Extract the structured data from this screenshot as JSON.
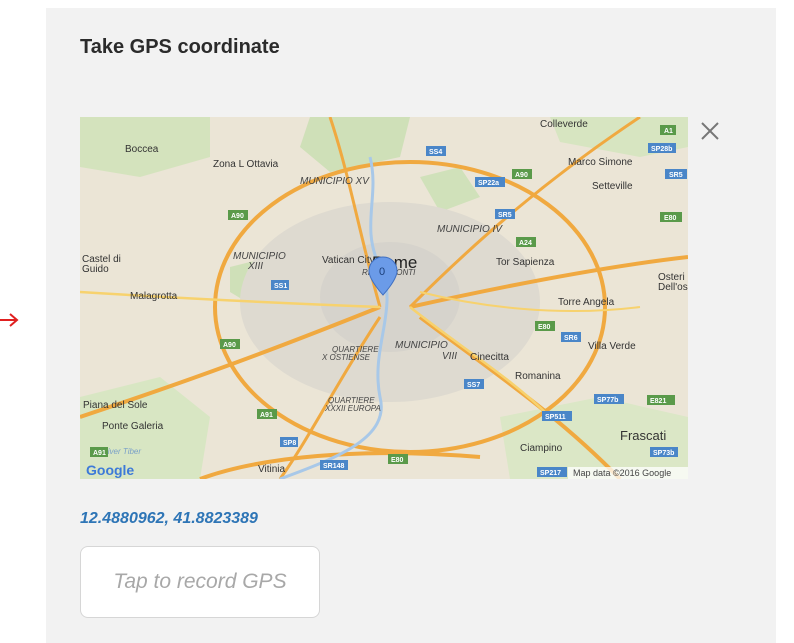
{
  "title": "Take GPS coordinate",
  "coordinates": "12.4880962, 41.8823389",
  "record_button": {
    "label": "Tap to record GPS"
  },
  "icons": {
    "close": "close-icon",
    "map_pin": "map-pin-icon",
    "arrow": "arrow-right-icon"
  },
  "colors": {
    "accent": "#2e75b6",
    "arrow": "#e02020",
    "marker": "#6b9be8"
  },
  "map": {
    "city_label": "Rome",
    "marker_label": "0",
    "attribution": "Map data ©2016 Google",
    "logo": "Google",
    "place_labels": [
      "Boccea",
      "Zona L Ottavia",
      "Colleverde",
      "Marco Simone",
      "Setteville",
      "Castel di",
      "Guido",
      "Malagrotta",
      "Vatican City",
      "Tor Sapienza",
      "Osteri",
      "Dell'os",
      "Torre Angela",
      "Villa Verde",
      "Cinecitta",
      "Romanina",
      "Piana del Sole",
      "Ponte Galeria",
      "Ciampino",
      "Frascati",
      "Vitinia"
    ],
    "district_labels": [
      "MUNICIPIO XV",
      "MUNICIPIO IV",
      "MUNICIPIO",
      "XIII",
      "MUNICIPIO",
      "VIII",
      "RIONE MONTI",
      "QUARTIERE",
      "X OSTIENSE",
      "QUARTIERE",
      "XXXII EUROPA",
      "River Tiber"
    ],
    "road_shields": [
      "SS4",
      "SP28b",
      "A1",
      "A90",
      "SP22a",
      "SR5",
      "SR5",
      "E80",
      "A90",
      "A24",
      "SS1",
      "A90",
      "E80",
      "SR6",
      "SS7",
      "SP77b",
      "E821",
      "SP511",
      "A91",
      "SP8",
      "SR148",
      "E80",
      "SP73b",
      "SP217",
      "A91"
    ]
  }
}
